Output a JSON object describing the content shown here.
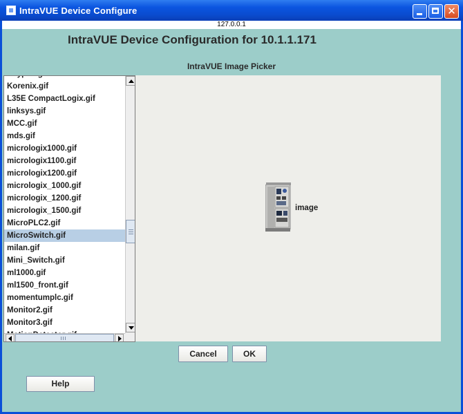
{
  "window": {
    "title": "IntraVUE Device Configure",
    "host": "127.0.0.1"
  },
  "header": {
    "title": "IntraVUE Device Configuration for 10.1.1.171",
    "subtitle": "IntraVUE Image Picker"
  },
  "image_list": {
    "items": [
      "Keypad.gif",
      "Korenix.gif",
      "L35E CompactLogix.gif",
      "linksys.gif",
      "MCC.gif",
      "mds.gif",
      "micrologix1000.gif",
      "micrologix1100.gif",
      "micrologix1200.gif",
      "micrologix_1000.gif",
      "micrologix_1200.gif",
      "micrologix_1500.gif",
      "MicroPLC2.gif",
      "MicroSwitch.gif",
      "milan.gif",
      "Mini_Switch.gif",
      "ml1000.gif",
      "ml1500_front.gif",
      "momentumplc.gif",
      "Monitor2.gif",
      "Monitor3.gif",
      "MotionDetector.gif"
    ],
    "selected": "MicroSwitch.gif"
  },
  "preview": {
    "label": "image",
    "icon": "microswitch-device-icon"
  },
  "buttons": {
    "cancel": "Cancel",
    "ok": "OK",
    "help": "Help"
  },
  "colors": {
    "background": "#9ccdc9",
    "titlebar": "#0b55e0",
    "selection": "#b8cfe5"
  }
}
